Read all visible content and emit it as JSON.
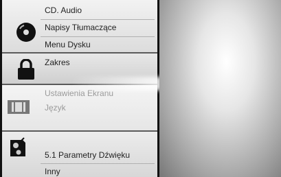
{
  "menu": {
    "disc": {
      "items": [
        "CD. Audio",
        "Napisy Tłumaczące",
        "Menu Dysku"
      ]
    },
    "lock": {
      "items": [
        "Zakres"
      ]
    },
    "display": {
      "items": [
        "Ustawienia Ekranu",
        "Język"
      ]
    },
    "audio": {
      "items": [
        "5.1 Parametry Dźwięku",
        "Inny"
      ]
    }
  },
  "icons": [
    "disc-icon",
    "padlock-icon",
    "screen-icon",
    "speaker-icon"
  ]
}
